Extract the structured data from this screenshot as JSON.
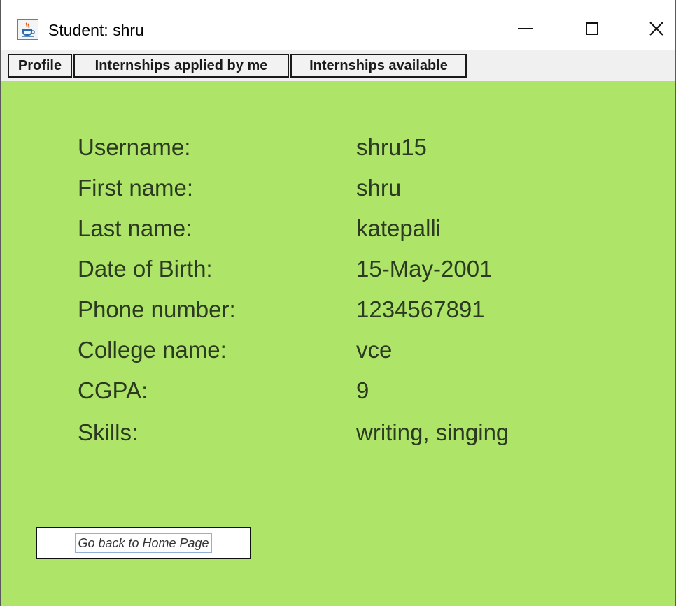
{
  "window": {
    "title": "Student: shru",
    "icon": "java-cup-icon",
    "controls": [
      "minimize-icon",
      "maximize-icon",
      "close-icon"
    ]
  },
  "tabs": [
    {
      "label": "Profile"
    },
    {
      "label": "Internships applied by me"
    },
    {
      "label": "Internships available"
    }
  ],
  "profile": {
    "rows": [
      {
        "label": "Username:",
        "value": "shru15"
      },
      {
        "label": "First name:",
        "value": "shru"
      },
      {
        "label": "Last name:",
        "value": "katepalli"
      },
      {
        "label": "Date of Birth:",
        "value": "15-May-2001"
      },
      {
        "label": "Phone number:",
        "value": "1234567891"
      },
      {
        "label": "College name:",
        "value": "vce"
      },
      {
        "label": "CGPA:",
        "value": "9"
      },
      {
        "label": "Skills:",
        "value": "writing, singing"
      }
    ]
  },
  "actions": {
    "home_label": "Go back to Home Page"
  },
  "colors": {
    "panel_background": "#aee569",
    "text": "#2b3a20"
  }
}
